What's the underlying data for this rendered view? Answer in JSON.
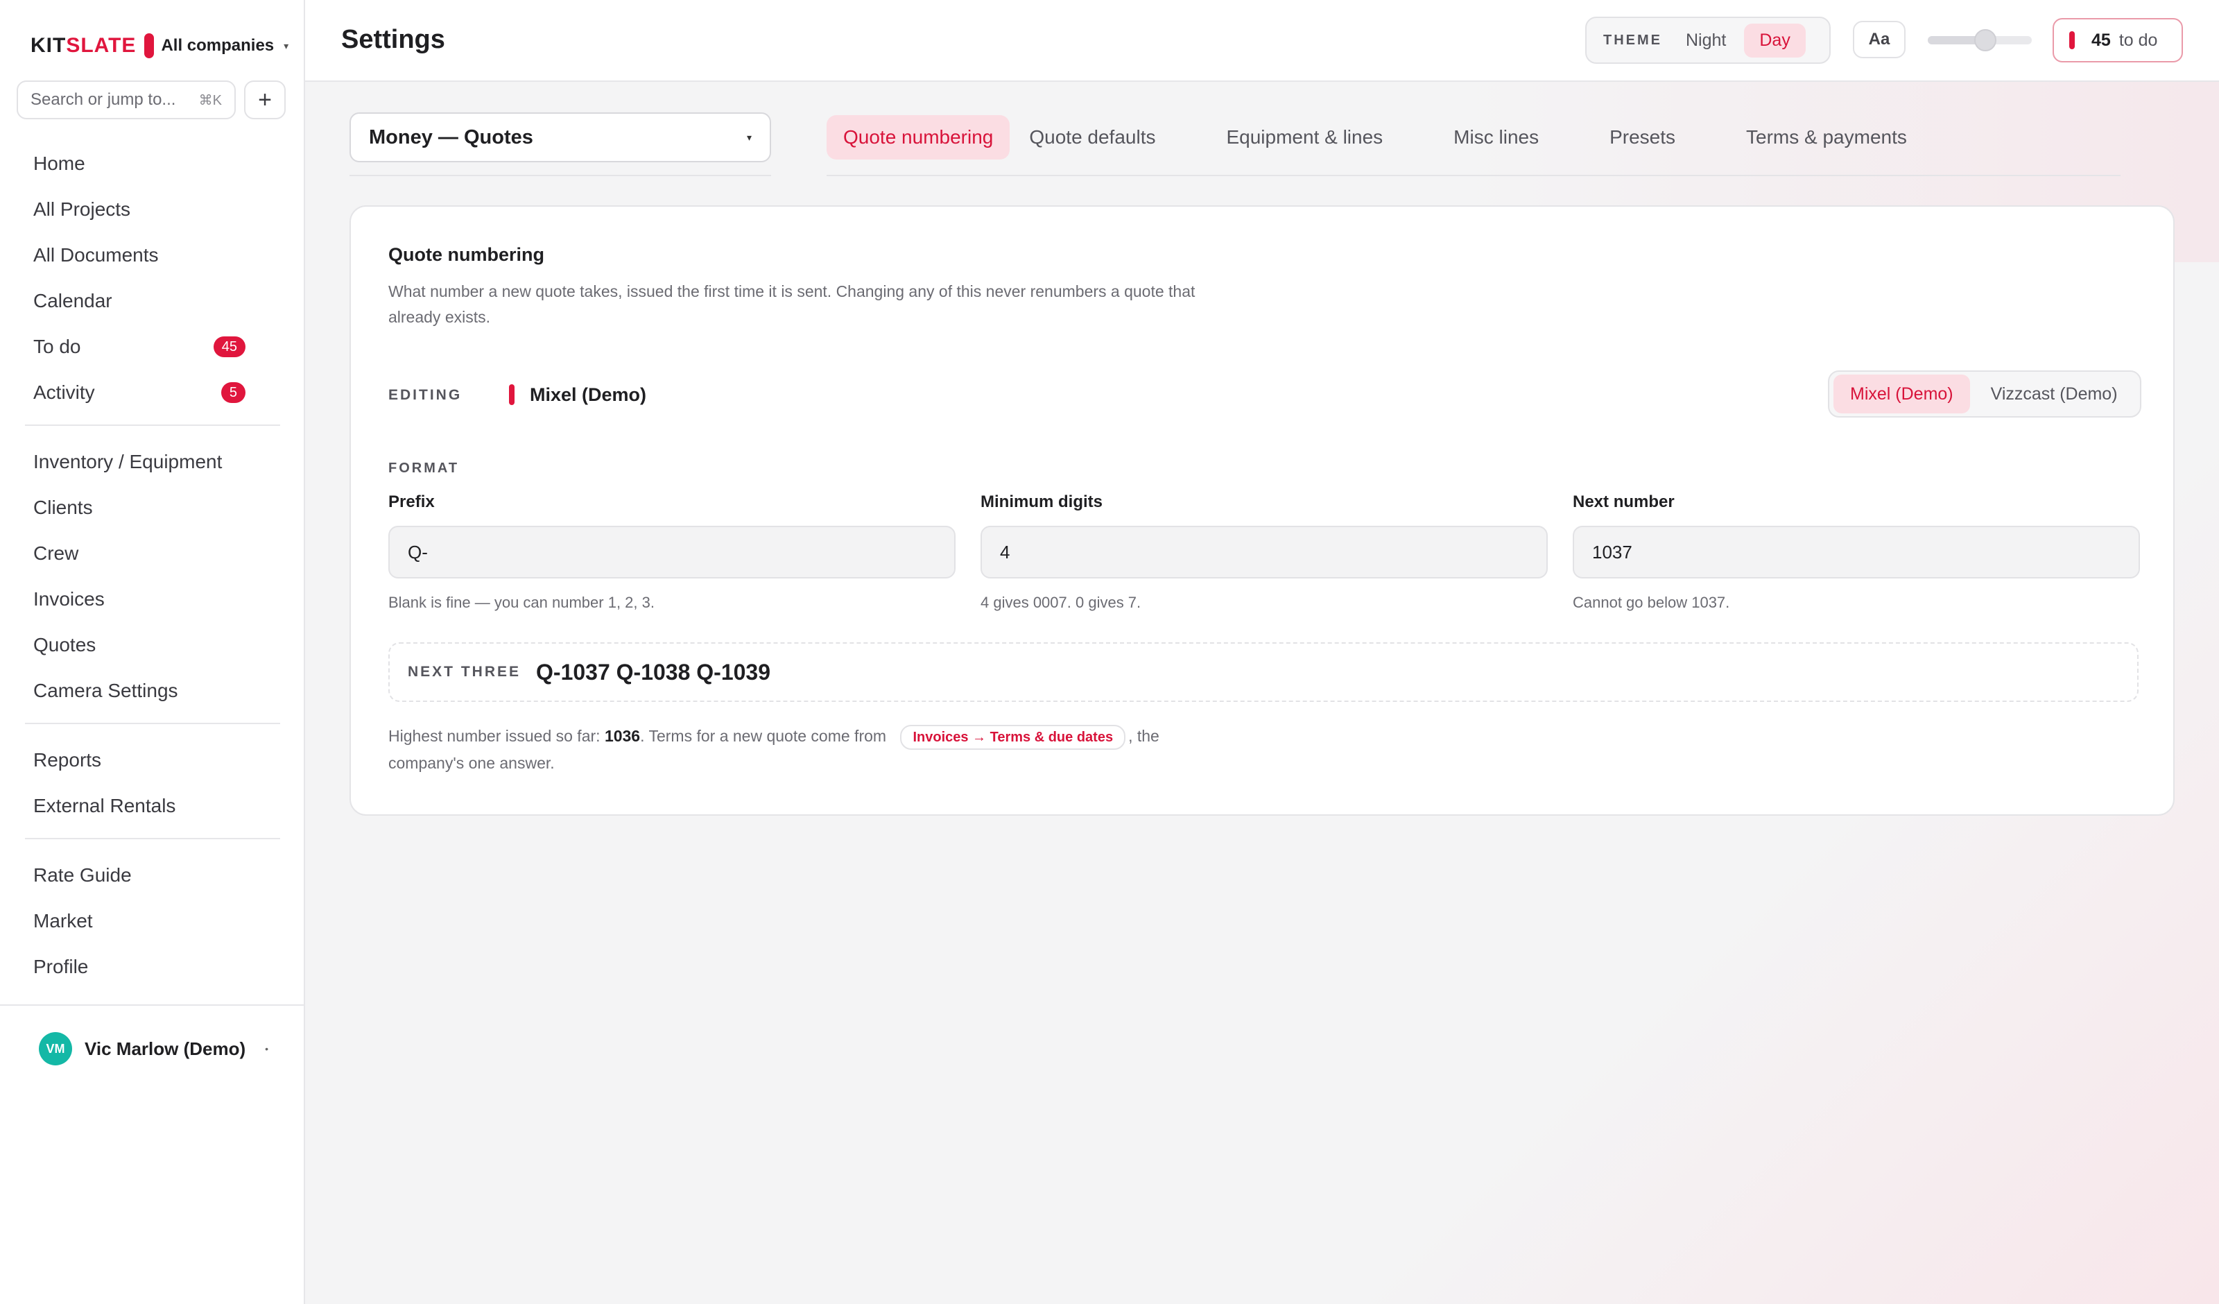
{
  "brand": {
    "name_main": "KIT",
    "name_accent": "SLATE",
    "company": "All companies"
  },
  "search": {
    "placeholder": "Search or jump to...",
    "shortcut": "⌘K"
  },
  "sidebar": {
    "items": [
      {
        "label": "Home"
      },
      {
        "label": "All Projects"
      },
      {
        "label": "All Documents"
      },
      {
        "label": "Calendar"
      },
      {
        "label": "To do",
        "badge": "45"
      },
      {
        "label": "Activity",
        "badge": "5"
      },
      {
        "label": "Inventory / Equipment"
      },
      {
        "label": "Clients"
      },
      {
        "label": "Crew"
      },
      {
        "label": "Invoices"
      },
      {
        "label": "Quotes"
      },
      {
        "label": "Camera Settings"
      },
      {
        "label": "Reports"
      },
      {
        "label": "External Rentals"
      },
      {
        "label": "Rate Guide"
      },
      {
        "label": "Market"
      },
      {
        "label": "Profile"
      }
    ],
    "user": {
      "initials": "VM",
      "name": "Vic Marlow (Demo)"
    }
  },
  "header": {
    "title": "Settings",
    "theme": {
      "label": "THEME",
      "options": [
        "Night",
        "Day"
      ],
      "selected": "Day"
    },
    "font_button": "Aa",
    "font_scale": 0.55,
    "todo": {
      "count": "45",
      "label": "to do"
    }
  },
  "section": {
    "selected": "Money — Quotes"
  },
  "tabs": [
    {
      "label": "Quote numbering",
      "active": true
    },
    {
      "label": "Quote defaults"
    },
    {
      "label": "Equipment & lines"
    },
    {
      "label": "Misc lines"
    },
    {
      "label": "Presets"
    },
    {
      "label": "Terms & payments"
    }
  ],
  "card": {
    "title": "Quote numbering",
    "description": "What number a new quote takes, issued the first time it is sent. Changing any of this never renumbers a quote that already exists.",
    "editing_label": "EDITING",
    "editing_company": "Mixel (Demo)",
    "companies": [
      "Mixel (Demo)",
      "Vizzcast (Demo)"
    ],
    "format_label": "FORMAT",
    "fields": {
      "prefix": {
        "label": "Prefix",
        "value": "Q-",
        "help": "Blank is fine — you can number 1, 2, 3."
      },
      "min_digits": {
        "label": "Minimum digits",
        "value": "4",
        "help": "4 gives 0007. 0 gives 7."
      },
      "next_number": {
        "label": "Next number",
        "value": "1037",
        "help": "Cannot go below 1037."
      }
    },
    "next_three_label": "NEXT THREE",
    "next_three_value": "Q-1037 Q-1038 Q-1039",
    "footnote": {
      "prefix": "Highest number issued so far: ",
      "highest": "1036",
      "middle": ". Terms for a new quote come from ",
      "link": "Invoices → Terms & due dates",
      "suffix": ", the company's one answer."
    }
  },
  "colors": {
    "accent": "#e0163d",
    "accent_soft": "#fbdde3",
    "avatar": "#14b8a6"
  }
}
